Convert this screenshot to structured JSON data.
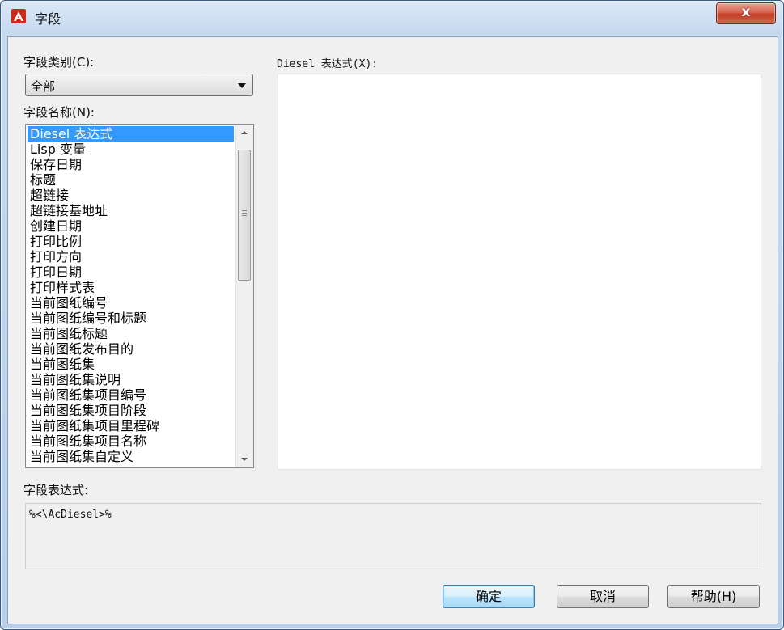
{
  "window": {
    "title": "字段",
    "close_label": "x",
    "icon": "autocad-logo-icon",
    "accent_color": "#cc2a1c"
  },
  "left": {
    "category_label": "字段类别(C):",
    "category_value": "全部",
    "names_label": "字段名称(N):",
    "names": [
      "Diesel 表达式",
      "Lisp 变量",
      "保存日期",
      "标题",
      "超链接",
      "超链接基地址",
      "创建日期",
      "打印比例",
      "打印方向",
      "打印日期",
      "打印样式表",
      "当前图纸编号",
      "当前图纸编号和标题",
      "当前图纸标题",
      "当前图纸发布目的",
      "当前图纸集",
      "当前图纸集说明",
      "当前图纸集项目编号",
      "当前图纸集项目阶段",
      "当前图纸集项目里程碑",
      "当前图纸集项目名称",
      "当前图纸集自定义"
    ],
    "selected_index": 0
  },
  "right": {
    "expr_label": "Diesel 表达式(X):",
    "expr_value": ""
  },
  "bottom": {
    "field_expr_label": "字段表达式:",
    "field_expr_value": "%<\\AcDiesel>%"
  },
  "buttons": {
    "ok": "确定",
    "cancel": "取消",
    "help": "帮助(H)"
  }
}
